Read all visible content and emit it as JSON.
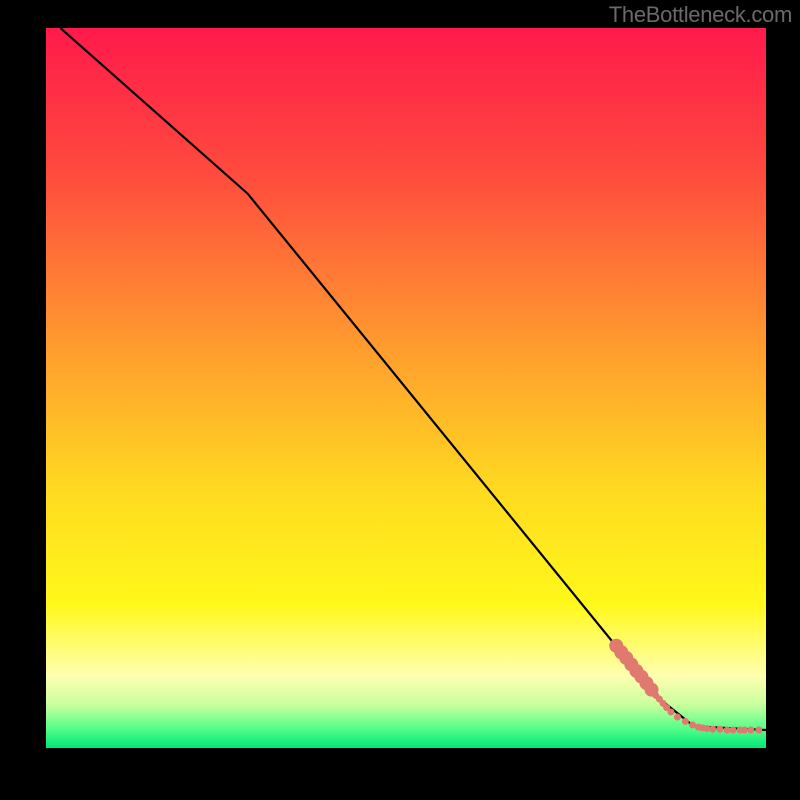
{
  "watermark": "TheBottleneck.com",
  "chart_data": {
    "type": "line",
    "title": "",
    "xlabel": "",
    "ylabel": "",
    "xlim": [
      0,
      100
    ],
    "ylim": [
      0,
      100
    ],
    "gradient_stops": [
      {
        "offset": 0.0,
        "color": "#ff1a4b"
      },
      {
        "offset": 0.2,
        "color": "#ff4a3e"
      },
      {
        "offset": 0.45,
        "color": "#ff9e2e"
      },
      {
        "offset": 0.65,
        "color": "#ffdc20"
      },
      {
        "offset": 0.8,
        "color": "#fff81a"
      },
      {
        "offset": 0.9,
        "color": "#ffffb0"
      },
      {
        "offset": 0.94,
        "color": "#c8ff9e"
      },
      {
        "offset": 0.97,
        "color": "#5fff8a"
      },
      {
        "offset": 1.0,
        "color": "#00e878"
      }
    ],
    "series": [
      {
        "name": "curve",
        "color": "#000000",
        "points": [
          {
            "x": 2.0,
            "y": 100.0
          },
          {
            "x": 28.0,
            "y": 77.0
          },
          {
            "x": 85.0,
            "y": 7.0
          },
          {
            "x": 90.0,
            "y": 3.0
          },
          {
            "x": 100.0,
            "y": 2.5
          }
        ]
      }
    ],
    "markers": {
      "name": "dots",
      "color": "#e07a6f",
      "points": [
        {
          "x": 79.2,
          "y": 14.2,
          "r": 1.0
        },
        {
          "x": 79.9,
          "y": 13.3,
          "r": 1.0
        },
        {
          "x": 80.6,
          "y": 12.5,
          "r": 1.0
        },
        {
          "x": 81.3,
          "y": 11.6,
          "r": 1.0
        },
        {
          "x": 82.0,
          "y": 10.7,
          "r": 1.0
        },
        {
          "x": 82.7,
          "y": 9.9,
          "r": 1.0
        },
        {
          "x": 83.4,
          "y": 9.0,
          "r": 1.0
        },
        {
          "x": 84.1,
          "y": 8.1,
          "r": 1.0
        },
        {
          "x": 84.4,
          "y": 7.7,
          "r": 0.5
        },
        {
          "x": 84.7,
          "y": 7.3,
          "r": 0.5
        },
        {
          "x": 85.2,
          "y": 6.8,
          "r": 0.5
        },
        {
          "x": 85.7,
          "y": 6.2,
          "r": 0.5
        },
        {
          "x": 86.2,
          "y": 5.6,
          "r": 0.5
        },
        {
          "x": 86.8,
          "y": 5.0,
          "r": 0.5
        },
        {
          "x": 87.7,
          "y": 4.3,
          "r": 0.5
        },
        {
          "x": 88.8,
          "y": 3.7,
          "r": 0.5
        },
        {
          "x": 89.8,
          "y": 3.2,
          "r": 0.5
        },
        {
          "x": 90.6,
          "y": 2.9,
          "r": 0.5
        },
        {
          "x": 91.2,
          "y": 2.8,
          "r": 0.5
        },
        {
          "x": 91.8,
          "y": 2.7,
          "r": 0.5
        },
        {
          "x": 92.6,
          "y": 2.6,
          "r": 0.5
        },
        {
          "x": 93.6,
          "y": 2.6,
          "r": 0.5
        },
        {
          "x": 94.6,
          "y": 2.5,
          "r": 0.5
        },
        {
          "x": 95.4,
          "y": 2.5,
          "r": 0.5
        },
        {
          "x": 96.4,
          "y": 2.5,
          "r": 0.5
        },
        {
          "x": 97.0,
          "y": 2.5,
          "r": 0.5
        },
        {
          "x": 97.9,
          "y": 2.5,
          "r": 0.5
        },
        {
          "x": 99.0,
          "y": 2.5,
          "r": 0.5
        }
      ]
    }
  }
}
